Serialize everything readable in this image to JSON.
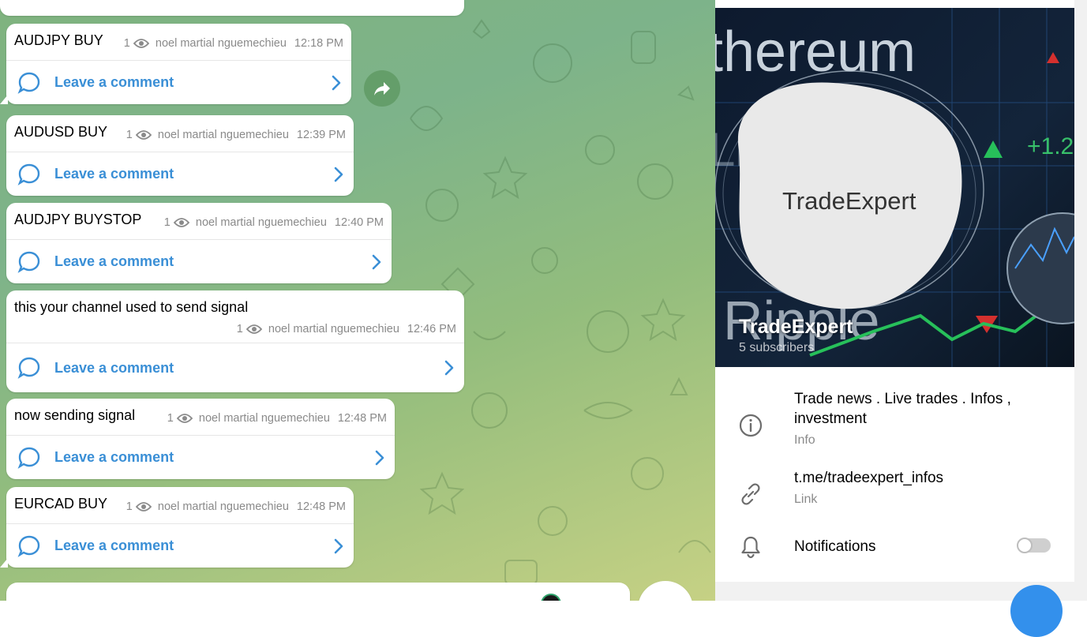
{
  "chat": {
    "posts": [
      {
        "text": "AUDJPY BUY",
        "views": "1",
        "author": "noel martial nguemechieu",
        "time": "12:18 PM",
        "comment_label": "Leave a comment"
      },
      {
        "text": "AUDUSD BUY",
        "views": "1",
        "author": "noel martial nguemechieu",
        "time": "12:39 PM",
        "comment_label": "Leave a comment"
      },
      {
        "text": "AUDJPY BUYSTOP",
        "views": "1",
        "author": "noel martial nguemechieu",
        "time": "12:40 PM",
        "comment_label": "Leave a comment"
      },
      {
        "text": "this your channel used to send signal",
        "views": "1",
        "author": "noel martial nguemechieu",
        "time": "12:46 PM",
        "comment_label": "Leave a comment"
      },
      {
        "text": "now sending signal",
        "views": "1",
        "author": "noel martial nguemechieu",
        "time": "12:48 PM",
        "comment_label": "Leave a comment"
      },
      {
        "text": "EURCAD BUY",
        "views": "1",
        "author": "noel martial nguemechieu",
        "time": "12:48 PM",
        "comment_label": "Leave a comment"
      }
    ]
  },
  "channel": {
    "banner_logo_text": "TradeExpert",
    "banner_bg_words": [
      "thereum",
      "Lit",
      "Ripple",
      "+1.2"
    ],
    "name": "TradeExpert",
    "subscribers": "5 subscribers",
    "info": {
      "value": "Trade news . Live trades . Infos , investment",
      "label": "Info"
    },
    "link": {
      "value": "t.me/tradeexpert_infos",
      "label": "Link"
    },
    "notifications": {
      "label": "Notifications",
      "enabled": false
    }
  },
  "colors": {
    "accent": "#3390ec",
    "link_blue": "#3a8fd6",
    "meta_gray": "#8a8a8a"
  }
}
